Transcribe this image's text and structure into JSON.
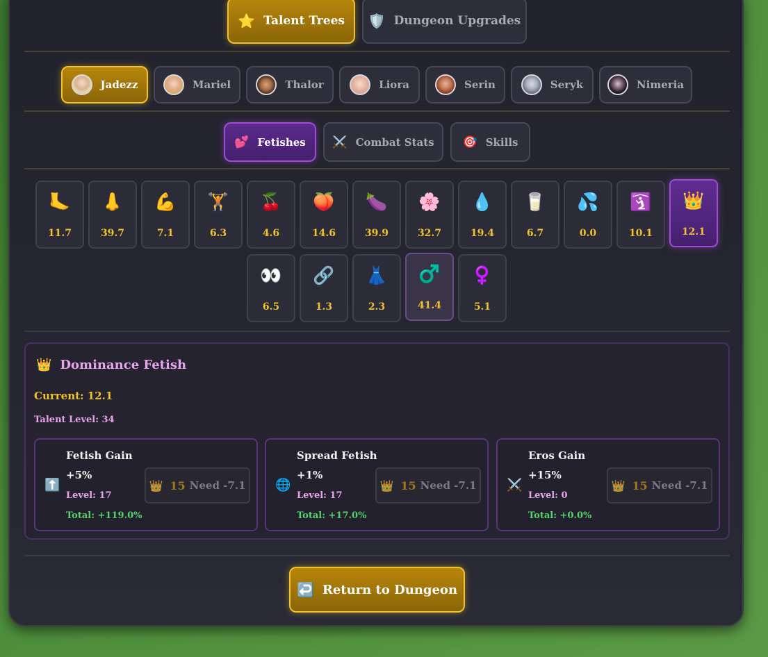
{
  "main_tabs": [
    {
      "icon": "⭐",
      "label": "Talent Trees",
      "active": true
    },
    {
      "icon": "🛡️",
      "label": "Dungeon Upgrades",
      "active": false
    }
  ],
  "characters": [
    {
      "name": "Jadezz",
      "active": true
    },
    {
      "name": "Mariel",
      "active": false
    },
    {
      "name": "Thalor",
      "active": false
    },
    {
      "name": "Liora",
      "active": false
    },
    {
      "name": "Serin",
      "active": false
    },
    {
      "name": "Seryk",
      "active": false
    },
    {
      "name": "Nimeria",
      "active": false
    }
  ],
  "sub_tabs": [
    {
      "icon": "💕",
      "label": "Fetishes",
      "active": true
    },
    {
      "icon": "⚔️",
      "label": "Combat Stats",
      "active": false
    },
    {
      "icon": "🎯",
      "label": "Skills",
      "active": false
    }
  ],
  "fetishes": [
    {
      "icon": "🦶",
      "value": "11.7"
    },
    {
      "icon": "👃",
      "value": "39.7"
    },
    {
      "icon": "💪",
      "value": "7.1"
    },
    {
      "icon": "🏋️",
      "value": "6.3"
    },
    {
      "icon": "🍒",
      "value": "4.6"
    },
    {
      "icon": "🍑",
      "value": "14.6"
    },
    {
      "icon": "🍆",
      "value": "39.9"
    },
    {
      "icon": "🌸",
      "value": "32.7"
    },
    {
      "icon": "💧",
      "value": "19.4"
    },
    {
      "icon": "🥛",
      "value": "6.7"
    },
    {
      "icon": "💦",
      "value": "0.0"
    },
    {
      "icon": "🛐",
      "value": "10.1"
    },
    {
      "icon": "👑",
      "value": "12.1",
      "selected": true
    },
    {
      "icon": "👀",
      "value": "6.5"
    },
    {
      "icon": "🔗",
      "value": "1.3"
    },
    {
      "icon": "👗",
      "value": "2.3"
    },
    {
      "icon": "♂️",
      "value": "41.4",
      "highlighted": true
    },
    {
      "icon": "♀️",
      "value": "5.1"
    }
  ],
  "detail": {
    "icon": "👑",
    "title": "Dominance Fetish",
    "current": "Current: 12.1",
    "talent_level": "Talent Level: 34"
  },
  "upgrades": [
    {
      "icon": "⬆️",
      "name": "Fetish Gain",
      "bonus": "+5%",
      "level": "Level: 17",
      "total": "Total: +119.0%",
      "cost_icon": "👑",
      "cost": "15",
      "need": "Need -7.1"
    },
    {
      "icon": "🌐",
      "name": "Spread Fetish",
      "bonus": "+1%",
      "level": "Level: 17",
      "total": "Total: +17.0%",
      "cost_icon": "👑",
      "cost": "15",
      "need": "Need -7.1"
    },
    {
      "icon": "⚔️",
      "name": "Eros Gain",
      "bonus": "+15%",
      "level": "Level: 0",
      "total": "Total: +0.0%",
      "cost_icon": "👑",
      "cost": "15",
      "need": "Need -7.1"
    }
  ],
  "return_button": {
    "icon": "↩️",
    "label": "Return to Dungeon"
  },
  "colors": {
    "gold": "#f2c12e",
    "purple": "#a04bd8",
    "pink": "#e7a6ec",
    "green": "#57d36a"
  }
}
